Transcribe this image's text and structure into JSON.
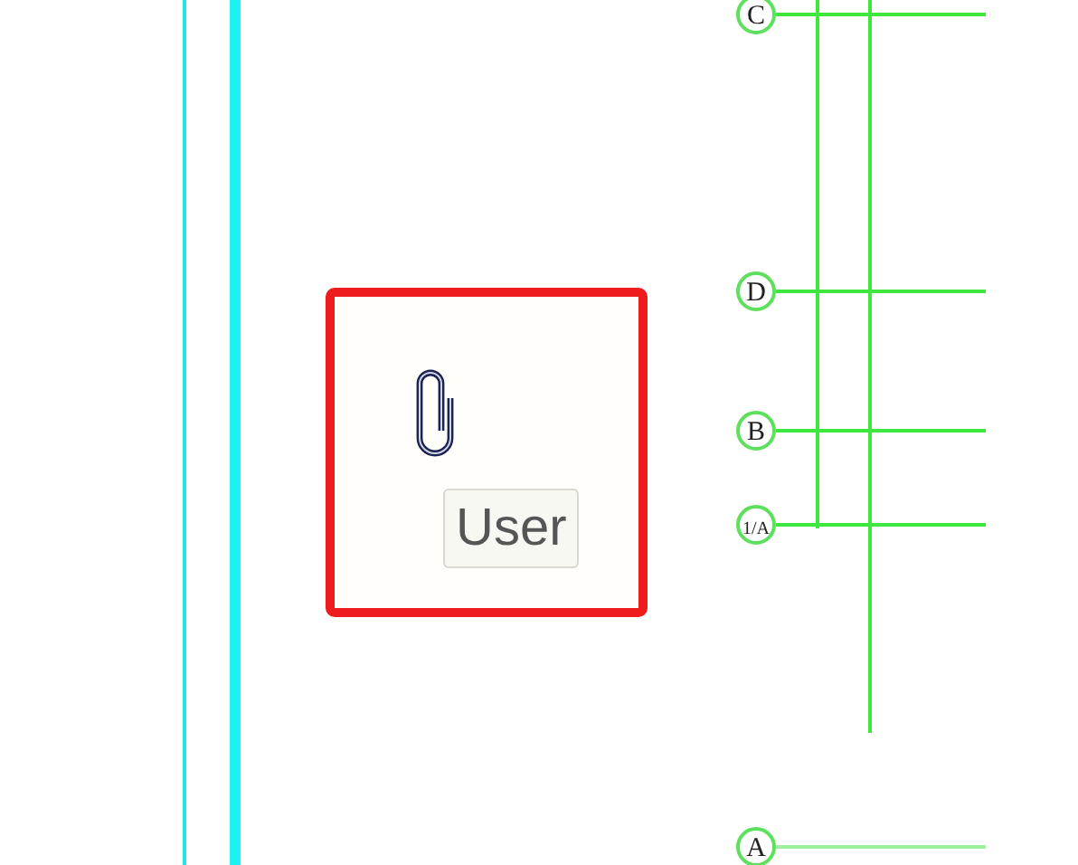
{
  "grid_axes": [
    {
      "label": "C"
    },
    {
      "label": "D"
    },
    {
      "label": "B"
    },
    {
      "label": "1/A"
    },
    {
      "label": "A"
    }
  ],
  "comment_marker": {
    "tooltip": "User"
  }
}
